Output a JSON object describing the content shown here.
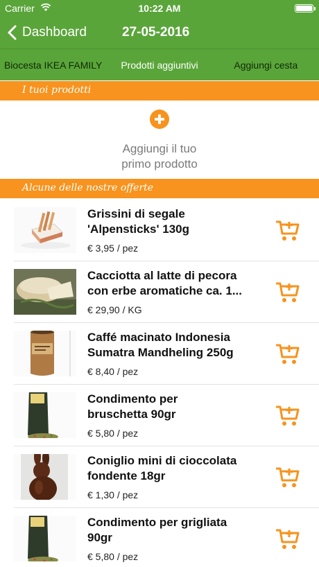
{
  "status_bar": {
    "carrier": "Carrier",
    "time": "10:22 AM"
  },
  "nav": {
    "back_label": "Dashboard",
    "title": "27-05-2016"
  },
  "tabs": [
    {
      "label": "Biocesta IKEA FAMILY"
    },
    {
      "label": "Prodotti aggiuntivi"
    },
    {
      "label": "Aggiungi cesta"
    }
  ],
  "sections": {
    "my_products": "I tuoi prodotti",
    "offers": "Alcune delle nostre offerte"
  },
  "empty_state": {
    "line1": "Aggiungi il tuo",
    "line2": "primo prodotto"
  },
  "products": [
    {
      "name1": "Grissini di segale",
      "name2": "'Alpensticks' 130g",
      "price": "€ 3,95 / pez",
      "image": "breadsticks-box"
    },
    {
      "name1": "Cacciotta al latte di pecora",
      "name2": "con erbe aromatiche ca. 1...",
      "price": "€ 29,90 / KG",
      "image": "cheese-wheel"
    },
    {
      "name1": "Caffé macinato Indonesia",
      "name2": "Sumatra Mandheling 250g",
      "price": "€ 8,40 / pez",
      "image": "coffee-canister"
    },
    {
      "name1": "Condimento per",
      "name2": "bruschetta 90gr",
      "price": "€ 5,80 / pez",
      "image": "spice-bag"
    },
    {
      "name1": "Coniglio mini di cioccolata",
      "name2": "fondente 18gr",
      "price": "€ 1,30 / pez",
      "image": "chocolate-bunny"
    },
    {
      "name1": "Condimento per grigliata",
      "name2": "90gr",
      "price": "€ 5,80 / pez",
      "image": "spice-bag"
    }
  ],
  "colors": {
    "brand_green": "#5aa53a",
    "accent_orange": "#f7931e",
    "separator": "#e2e2e2"
  }
}
